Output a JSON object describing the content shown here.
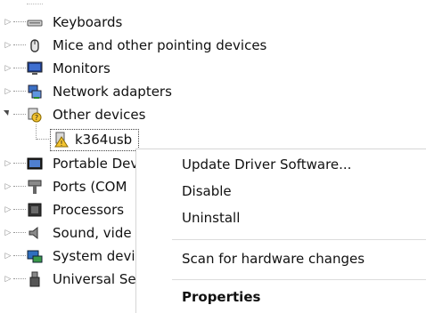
{
  "tree": {
    "items": [
      {
        "label": "Keyboards",
        "expanded": false,
        "icon": "keyboard-icon"
      },
      {
        "label": "Mice and other pointing devices",
        "expanded": false,
        "icon": "mouse-icon"
      },
      {
        "label": "Monitors",
        "expanded": false,
        "icon": "monitor-icon"
      },
      {
        "label": "Network adapters",
        "expanded": false,
        "icon": "network-adapter-icon"
      },
      {
        "label": "Other devices",
        "expanded": true,
        "icon": "other-devices-icon"
      },
      {
        "label": "k364usb",
        "child": true,
        "selected": true,
        "icon": "unknown-device-warning-icon"
      },
      {
        "label": "Portable Dev",
        "expanded": false,
        "icon": "portable-device-icon"
      },
      {
        "label": "Ports (COM",
        "expanded": false,
        "icon": "port-icon"
      },
      {
        "label": "Processors",
        "expanded": false,
        "icon": "processor-icon"
      },
      {
        "label": "Sound, vide",
        "expanded": false,
        "icon": "sound-icon"
      },
      {
        "label": "System devi",
        "expanded": false,
        "icon": "system-device-icon"
      },
      {
        "label": "Universal Se",
        "expanded": false,
        "icon": "usb-icon"
      }
    ]
  },
  "context_menu": {
    "items": [
      {
        "label": "Update Driver Software...",
        "bold": false
      },
      {
        "label": "Disable",
        "bold": false
      },
      {
        "label": "Uninstall",
        "bold": false
      },
      {
        "label": "Scan for hardware changes",
        "bold": false
      },
      {
        "label": "Properties",
        "bold": true
      }
    ]
  }
}
